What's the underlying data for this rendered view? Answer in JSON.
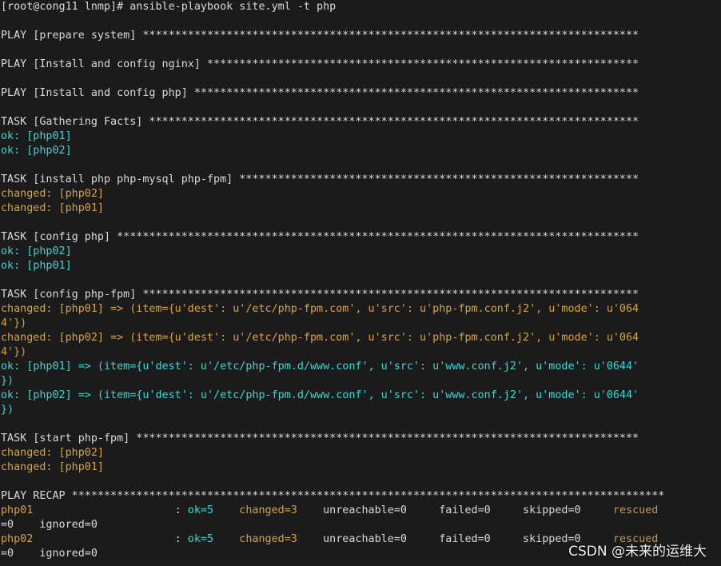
{
  "terminal": {
    "lines": [
      [
        {
          "t": "[root@cong11 lnmp]# ansible-playbook site.yml -t php",
          "c": "gray"
        }
      ],
      [],
      [
        {
          "t": "PLAY [prepare system] *****************************************************************************",
          "c": "gray"
        }
      ],
      [],
      [
        {
          "t": "PLAY [Install and config nginx] *******************************************************************",
          "c": "gray"
        }
      ],
      [],
      [
        {
          "t": "PLAY [Install and config php] *********************************************************************",
          "c": "gray"
        }
      ],
      [],
      [
        {
          "t": "TASK [Gathering Facts] ****************************************************************************",
          "c": "gray"
        }
      ],
      [
        {
          "t": "ok: [php01]",
          "c": "ok"
        }
      ],
      [
        {
          "t": "ok: [php02]",
          "c": "ok"
        }
      ],
      [],
      [
        {
          "t": "TASK [install php php-mysql php-fpm] **************************************************************",
          "c": "gray"
        }
      ],
      [
        {
          "t": "changed: [php02]",
          "c": "changed"
        }
      ],
      [
        {
          "t": "changed: [php01]",
          "c": "changed"
        }
      ],
      [],
      [
        {
          "t": "TASK [config php] *********************************************************************************",
          "c": "gray"
        }
      ],
      [
        {
          "t": "ok: [php02]",
          "c": "ok"
        }
      ],
      [
        {
          "t": "ok: [php01]",
          "c": "ok"
        }
      ],
      [],
      [
        {
          "t": "TASK [config php-fpm] *****************************************************************************",
          "c": "gray"
        }
      ],
      [
        {
          "t": "changed: [php01] => (item={u'dest': u'/etc/php-fpm.com', u'src': u'php-fpm.conf.j2', u'mode': u'064",
          "c": "changed"
        }
      ],
      [
        {
          "t": "4'})",
          "c": "changed"
        }
      ],
      [
        {
          "t": "changed: [php02] => (item={u'dest': u'/etc/php-fpm.com', u'src': u'php-fpm.conf.j2', u'mode': u'064",
          "c": "changed"
        }
      ],
      [
        {
          "t": "4'})",
          "c": "changed"
        }
      ],
      [
        {
          "t": "ok: [php01] => (item={u'dest': u'/etc/php-fpm.d/www.conf', u'src': u'www.conf.j2', u'mode': u'0644'",
          "c": "ok"
        }
      ],
      [
        {
          "t": "})",
          "c": "ok"
        }
      ],
      [
        {
          "t": "ok: [php02] => (item={u'dest': u'/etc/php-fpm.d/www.conf', u'src': u'www.conf.j2', u'mode': u'0644'",
          "c": "ok"
        }
      ],
      [
        {
          "t": "})",
          "c": "ok"
        }
      ],
      [],
      [
        {
          "t": "TASK [start php-fpm] ******************************************************************************",
          "c": "gray"
        }
      ],
      [
        {
          "t": "changed: [php02]",
          "c": "changed"
        }
      ],
      [
        {
          "t": "changed: [php01]",
          "c": "changed"
        }
      ],
      [],
      [
        {
          "t": "PLAY RECAP ********************************************************************************************",
          "c": "gray"
        }
      ],
      [
        {
          "t": "php01",
          "c": "changed"
        },
        {
          "t": "                      : ",
          "c": "gray"
        },
        {
          "t": "ok=5",
          "c": "ok"
        },
        {
          "t": "    ",
          "c": "gray"
        },
        {
          "t": "changed=3",
          "c": "changed"
        },
        {
          "t": "    unreachable=0     failed=0     skipped=0     ",
          "c": "gray"
        },
        {
          "t": "rescued",
          "c": "rescue"
        }
      ],
      [
        {
          "t": "=0    ignored=0",
          "c": "gray"
        }
      ],
      [
        {
          "t": "php02",
          "c": "changed"
        },
        {
          "t": "                      : ",
          "c": "gray"
        },
        {
          "t": "ok=5",
          "c": "ok"
        },
        {
          "t": "    ",
          "c": "gray"
        },
        {
          "t": "changed=3",
          "c": "changed"
        },
        {
          "t": "    unreachable=0     failed=0     skipped=0     ",
          "c": "gray"
        },
        {
          "t": "rescued",
          "c": "rescue"
        }
      ],
      [
        {
          "t": "=0    ignored=0",
          "c": "gray"
        }
      ]
    ]
  },
  "watermark": "CSDN @未来的运维大",
  "colors": {
    "background": "#1b1b1b",
    "text": "#d9d9d9",
    "ok": "#3ad6d6",
    "changed": "#d9a33f"
  }
}
